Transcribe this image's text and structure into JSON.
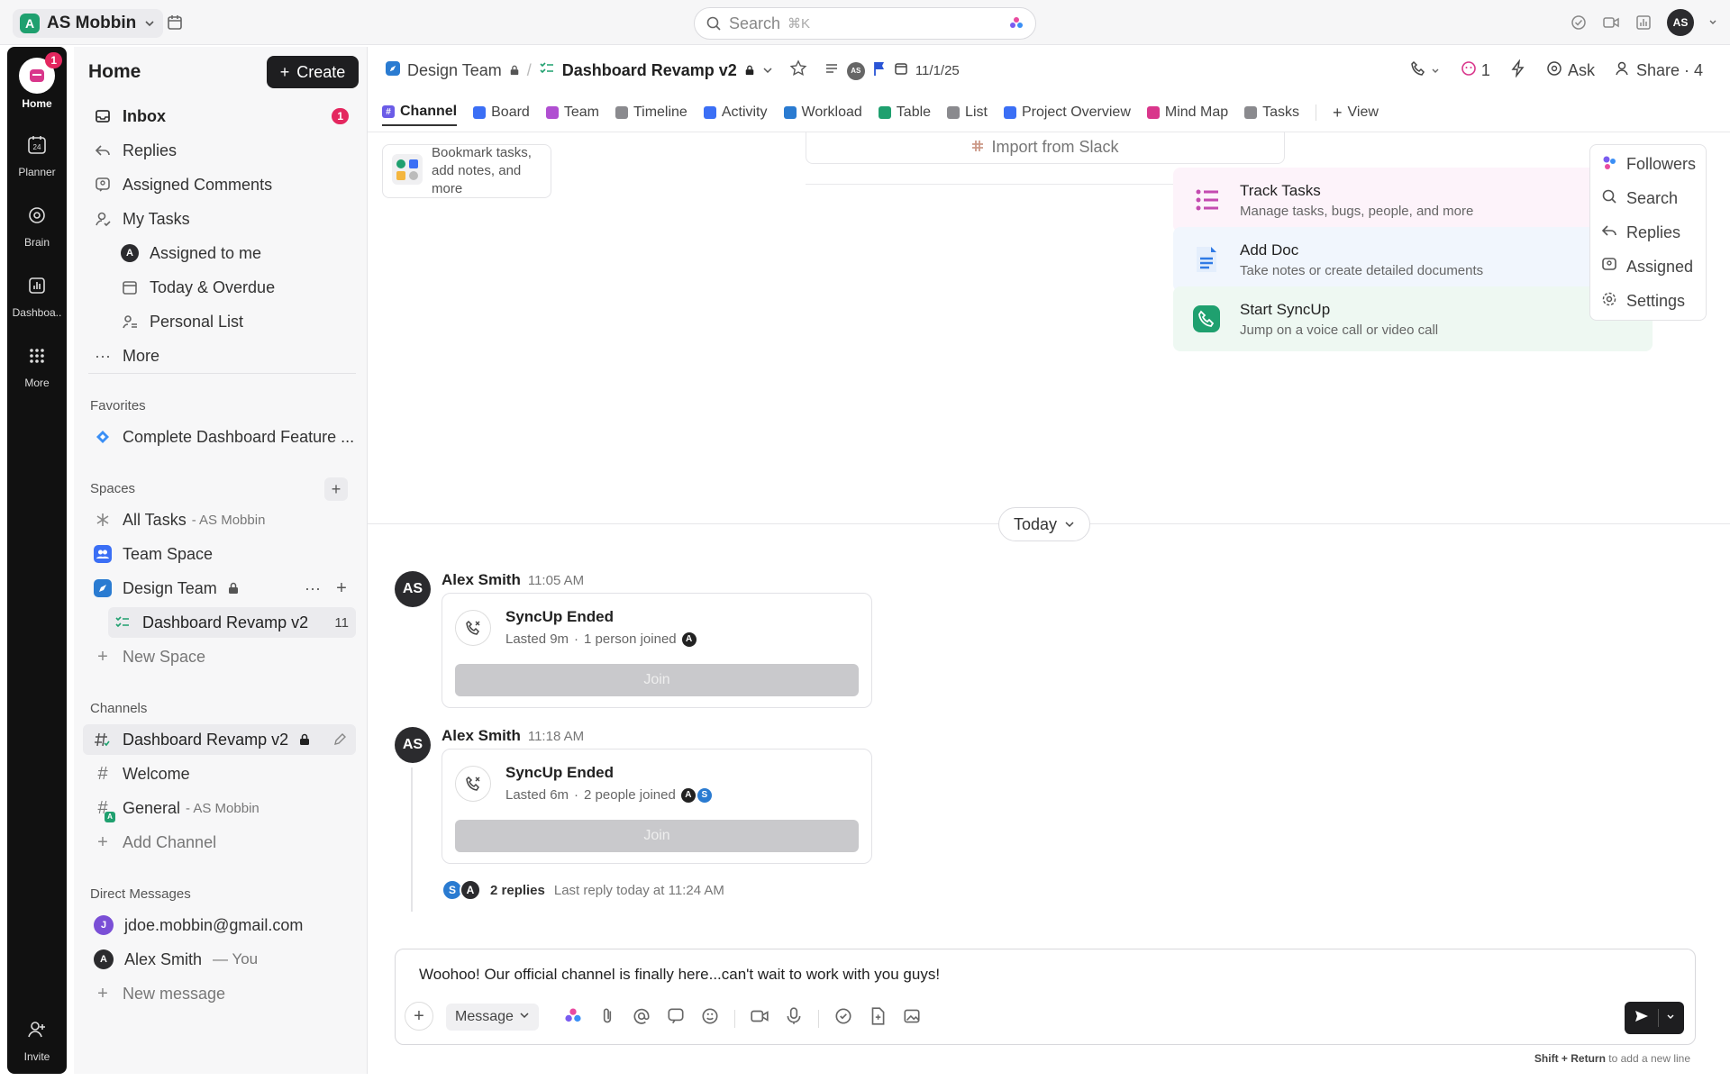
{
  "topbar": {
    "workspace_initial": "A",
    "workspace_name": "AS Mobbin",
    "search_placeholder": "Search",
    "search_shortcut": "⌘K",
    "user_initials": "AS"
  },
  "rail": {
    "home_label": "Home",
    "home_badge": "1",
    "planner_label": "Planner",
    "planner_day": "24",
    "brain_label": "Brain",
    "dashboards_label": "Dashboa..",
    "more_label": "More",
    "invite_label": "Invite"
  },
  "sidebar": {
    "title": "Home",
    "create_label": "Create",
    "inbox_label": "Inbox",
    "inbox_count": "1",
    "replies_label": "Replies",
    "assigned_comments_label": "Assigned Comments",
    "my_tasks_label": "My Tasks",
    "assigned_to_me_label": "Assigned to me",
    "assigned_avatar": "A",
    "today_overdue_label": "Today & Overdue",
    "personal_list_label": "Personal List",
    "more_label": "More",
    "favorites_heading": "Favorites",
    "favorite_item": "Complete Dashboard Feature ...",
    "spaces_heading": "Spaces",
    "all_tasks_label": "All Tasks",
    "all_tasks_suffix": "- AS Mobbin",
    "team_space_label": "Team Space",
    "design_team_label": "Design Team",
    "dashboard_revamp_label": "Dashboard Revamp v2",
    "dashboard_revamp_count": "11",
    "new_space_label": "New Space",
    "channels_heading": "Channels",
    "channel_active": "Dashboard Revamp v2",
    "channel_welcome": "Welcome",
    "channel_general": "General",
    "channel_general_suffix": "- AS Mobbin",
    "add_channel_label": "Add Channel",
    "dm_heading": "Direct Messages",
    "dm_1": "jdoe.mobbin@gmail.com",
    "dm_1_initial": "J",
    "dm_2": "Alex Smith",
    "dm_2_suffix": "— You",
    "dm_2_initial": "A",
    "new_message_label": "New message"
  },
  "header": {
    "crumb_space": "Design Team",
    "crumb_current": "Dashboard Revamp v2",
    "avatar_small": "AS",
    "date": "11/1/25",
    "notif_count": "1",
    "ask_label": "Ask",
    "share_label": "Share · 4"
  },
  "tabs": [
    {
      "label": "Channel",
      "color": "#6b5ce7",
      "glyph": "#"
    },
    {
      "label": "Board",
      "color": "#3b6ff5",
      "glyph": ""
    },
    {
      "label": "Team",
      "color": "#b04fd1",
      "glyph": ""
    },
    {
      "label": "Timeline",
      "color": "#8a8a8e",
      "glyph": ""
    },
    {
      "label": "Activity",
      "color": "#3b6ff5",
      "glyph": ""
    },
    {
      "label": "Workload",
      "color": "#2a7bd1",
      "glyph": ""
    },
    {
      "label": "Table",
      "color": "#1fa06f",
      "glyph": ""
    },
    {
      "label": "List",
      "color": "#8a8a8e",
      "glyph": ""
    },
    {
      "label": "Project Overview",
      "color": "#3b6ff5",
      "glyph": ""
    },
    {
      "label": "Mind Map",
      "color": "#d9368b",
      "glyph": ""
    },
    {
      "label": "Tasks",
      "color": "#8a8a8e",
      "glyph": ""
    }
  ],
  "view_label": "View",
  "channel": {
    "bookmark_text_1": "Bookmark tasks,",
    "bookmark_text_2": "add notes, and more",
    "import_slack_label": "Import from Slack",
    "cards": [
      {
        "title": "Track Tasks",
        "subtitle": "Manage tasks, bugs, people, and more",
        "bg": "#fdf3fa",
        "accent": "#c44bb0"
      },
      {
        "title": "Add Doc",
        "subtitle": "Take notes or create detailed documents",
        "bg": "#f1f6fd",
        "accent": "#2f7ae5"
      },
      {
        "title": "Start SyncUp",
        "subtitle": "Jump on a voice call or video call",
        "bg": "#eef8f2",
        "accent": "#1fa06f"
      }
    ],
    "date_divider": "Today",
    "messages": [
      {
        "author": "Alex Smith",
        "initials": "AS",
        "time": "11:05 AM",
        "title": "SyncUp Ended",
        "lasted": "Lasted 9m",
        "joined": "1 person joined",
        "join_label": "Join"
      },
      {
        "author": "Alex Smith",
        "initials": "AS",
        "time": "11:18 AM",
        "title": "SyncUp Ended",
        "lasted": "Lasted 6m",
        "joined": "2 people joined",
        "join_label": "Join"
      }
    ],
    "thread_replies": "2 replies",
    "thread_last": "Last reply today at 11:24 AM",
    "reply_avatar_1": "S",
    "reply_avatar_2": "A"
  },
  "right_panel": {
    "followers": "Followers",
    "search": "Search",
    "replies": "Replies",
    "assigned": "Assigned",
    "settings": "Settings"
  },
  "composer": {
    "text": "Woohoo! Our official channel is finally here...can't wait to work with you guys!",
    "mode_label": "Message",
    "hint_bold": "Shift + Return",
    "hint_rest": "to add a new line"
  },
  "colors": {
    "accent_pink": "#e4275f",
    "brand_green": "#1fa06f",
    "brand_blue": "#3b6ff5"
  }
}
